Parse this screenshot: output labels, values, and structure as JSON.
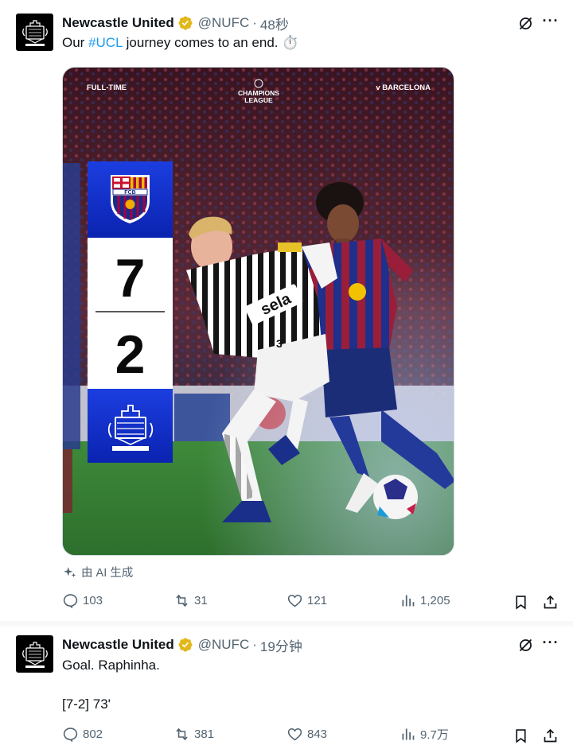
{
  "tweets": [
    {
      "author_name": "Newcastle United",
      "handle": "@NUFC",
      "separator": "·",
      "time": "48秒",
      "text_prefix": "Our ",
      "hashtag": "#UCL",
      "text_suffix": " journey comes to an end. ⏱️",
      "media": {
        "label_left": "FULL-TIME",
        "competition_line1": "CHAMPIONS",
        "competition_line2": "LEAGUE",
        "label_right": "v BARCELONA",
        "home_score": "7",
        "away_score": "2",
        "home_crest_text": "FCB",
        "shirt_sponsor": "sela",
        "shirt_number": "3"
      },
      "ai_label": "由 AI 生成",
      "stats": {
        "replies": "103",
        "reposts": "31",
        "likes": "121",
        "views": "1,205"
      }
    },
    {
      "author_name": "Newcastle United",
      "handle": "@NUFC",
      "separator": "·",
      "time": "19分钟",
      "line1": "Goal. Raphinha.",
      "line2": "[7-2] 73'",
      "stats": {
        "replies": "802",
        "reposts": "381",
        "likes": "843",
        "views": "9.7万"
      }
    }
  ],
  "icons": [
    "grok-icon",
    "more-icon",
    "reply-icon",
    "repost-icon",
    "like-icon",
    "views-icon",
    "bookmark-icon",
    "share-icon",
    "sparkle-icon",
    "verified-icon"
  ],
  "colors": {
    "accent": "#1d9bf0",
    "verified_gold": "#e2b719",
    "muted": "#536471",
    "score_blue": "#0a2fc8"
  }
}
